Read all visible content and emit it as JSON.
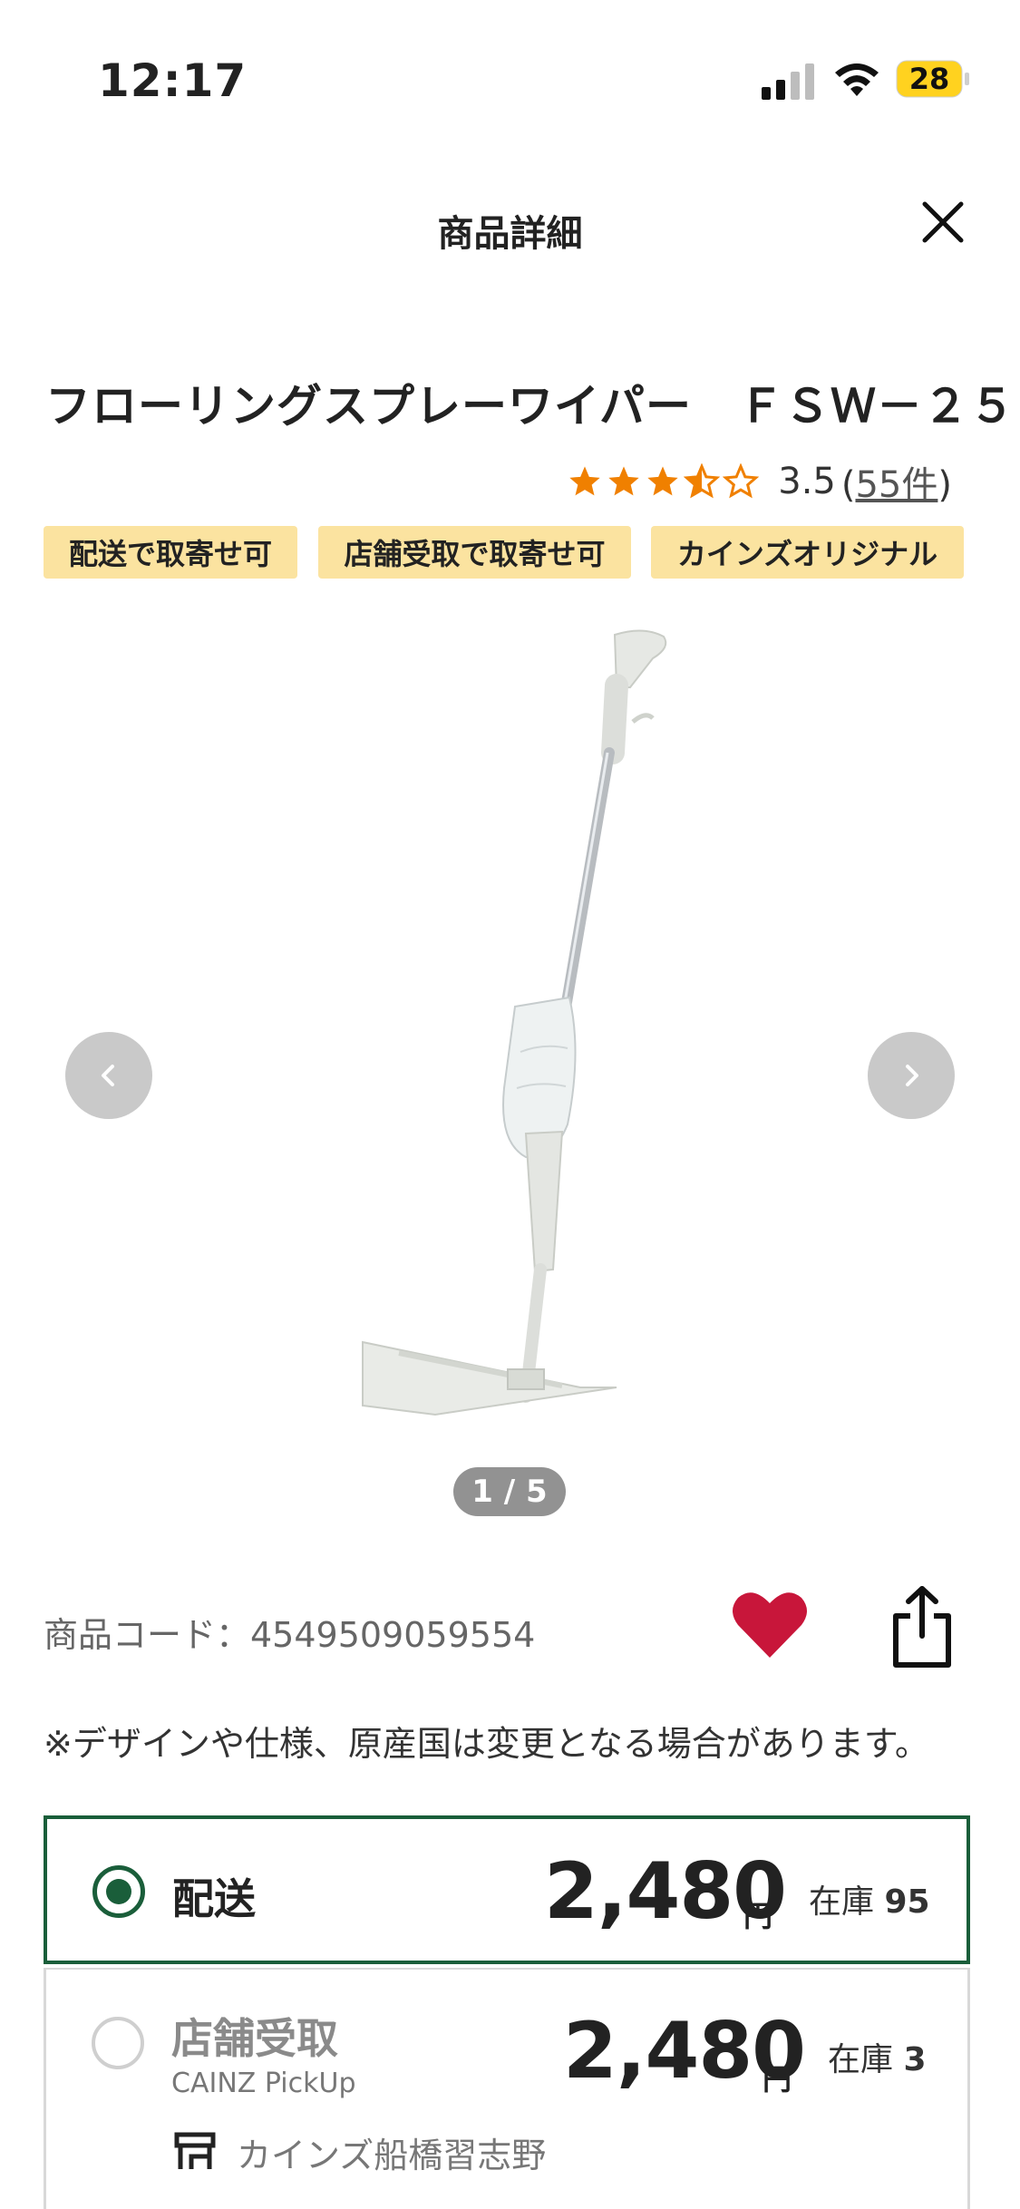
{
  "status_bar": {
    "time": "12:17",
    "battery": "28"
  },
  "header": {
    "title": "商品詳細"
  },
  "product": {
    "title": "フローリングスプレーワイパー　ＦＳＷ－２５",
    "rating": "3.5",
    "rating_value": 3.5,
    "review_count_link": "55件",
    "tags": [
      "配送で取寄せ可",
      "店舗受取で取寄せ可",
      "カインズオリジナル"
    ],
    "image_pager": "1 / 5",
    "code": "商品コード：4549509059554",
    "note": "※デザインや仕様、原産国は変更となる場合があります。"
  },
  "options": {
    "delivery": {
      "label": "配送",
      "price": "2,480",
      "yen": "円",
      "stock_label": "在庫",
      "stock": "95",
      "selected": true
    },
    "pickup": {
      "label": "店舗受取",
      "sub": "CAINZ PickUp",
      "store": "カインズ船橋習志野",
      "price": "2,480",
      "yen": "円",
      "stock_label": "在庫",
      "stock": "3",
      "selected": false
    }
  },
  "colors": {
    "accent_green": "#1a5e3a",
    "tag_bg": "#fbe3a0",
    "heart": "#c8163a",
    "star": "#f08000"
  },
  "icons": [
    "close-icon",
    "star-icon",
    "chevron-left-icon",
    "chevron-right-icon",
    "heart-icon",
    "share-icon",
    "store-icon"
  ]
}
